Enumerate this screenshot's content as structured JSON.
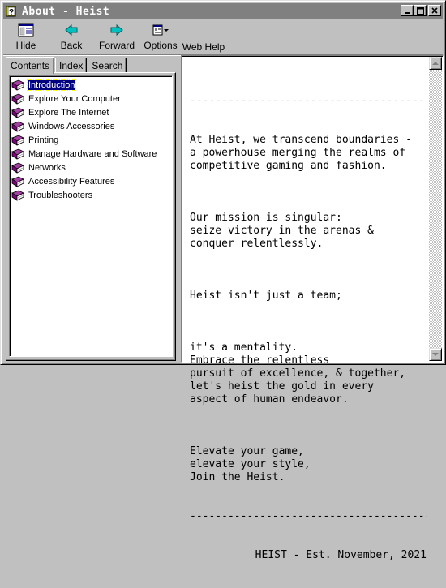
{
  "window": {
    "title": "About - Heist",
    "title_bar_color": "#808080"
  },
  "toolbar": {
    "hide_label": "Hide",
    "back_label": "Back",
    "forward_label": "Forward",
    "options_label": "Options",
    "webhelp_label": "Web Help",
    "arrow_color": "#00a0a0"
  },
  "tabs": {
    "contents": "Contents",
    "index": "Index",
    "search": "Search"
  },
  "tree": {
    "items": [
      {
        "label": "Introduction",
        "selected": true
      },
      {
        "label": "Explore Your Computer"
      },
      {
        "label": "Explore The Internet"
      },
      {
        "label": "Windows Accessories"
      },
      {
        "label": "Printing"
      },
      {
        "label": "Manage Hardware and Software"
      },
      {
        "label": "Networks"
      },
      {
        "label": "Accessibility Features"
      },
      {
        "label": "Troubleshooters"
      }
    ],
    "book_color": "#800080"
  },
  "content": {
    "divider": "--------------------------------------------------",
    "para1": [
      "At Heist, we transcend boundaries -",
      "a powerhouse merging the realms of",
      "competitive gaming and fashion."
    ],
    "para2": [
      "Our mission is singular:",
      "seize victory in the arenas &",
      "conquer relentlessly."
    ],
    "para3": [
      "Heist isn't just a team;"
    ],
    "para4": [
      "it's a mentality.",
      "Embrace the relentless",
      "pursuit of excellence, & together,",
      "let's heist the gold in every",
      "aspect of human endeavor."
    ],
    "para5": [
      "Elevate your game,",
      "elevate your style,",
      "Join the Heist."
    ],
    "footer": "HEIST - Est. November, 2021"
  }
}
